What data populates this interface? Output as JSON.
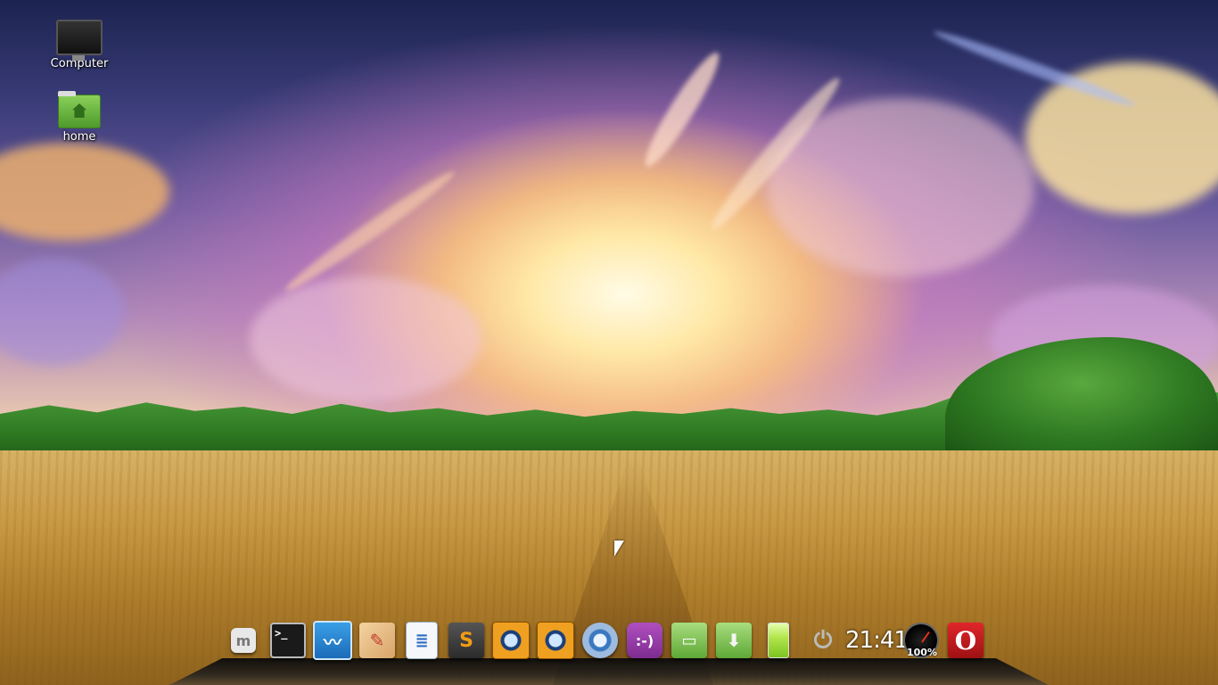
{
  "desktop": {
    "icons": [
      {
        "label": "Computer",
        "icon": "computer-monitor-icon"
      },
      {
        "label": "home",
        "icon": "home-folder-icon"
      }
    ]
  },
  "dock": {
    "items": [
      {
        "name": "mint-menu",
        "icon": "mint-logo-icon",
        "glyph": "m"
      },
      {
        "name": "terminal",
        "icon": "terminal-icon",
        "glyph": ">_"
      },
      {
        "name": "system-monitor",
        "icon": "system-monitor-icon",
        "glyph": "〰"
      },
      {
        "name": "paint",
        "icon": "paint-palette-icon",
        "glyph": "✎"
      },
      {
        "name": "writer",
        "icon": "document-icon",
        "glyph": "≣"
      },
      {
        "name": "sublime-text",
        "icon": "sublime-text-icon",
        "glyph": "S"
      },
      {
        "name": "eye-app-1",
        "icon": "eye-icon",
        "glyph": ""
      },
      {
        "name": "eye-app-2",
        "icon": "eye-icon",
        "glyph": ""
      },
      {
        "name": "chromium",
        "icon": "chromium-icon",
        "glyph": ""
      },
      {
        "name": "pidgin",
        "icon": "pidgin-chat-icon",
        "glyph": ":-)"
      },
      {
        "name": "files",
        "icon": "files-folder-icon",
        "glyph": "▭"
      },
      {
        "name": "downloads",
        "icon": "downloads-folder-icon",
        "glyph": "⬇"
      },
      {
        "name": "battery",
        "icon": "battery-icon",
        "glyph": ""
      },
      {
        "name": "power",
        "icon": "power-icon",
        "glyph": "⏻"
      }
    ],
    "clock": "21:41",
    "cpu_gauge_label": "100%",
    "opera": {
      "icon": "opera-icon",
      "glyph": "O"
    }
  }
}
